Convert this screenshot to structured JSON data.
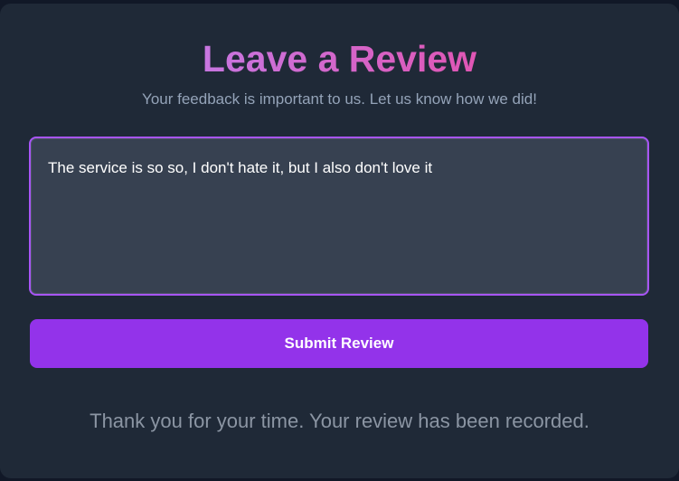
{
  "header": {
    "title": "Leave a Review",
    "subtitle": "Your feedback is important to us. Let us know how we did!"
  },
  "form": {
    "review_value": "The service is so so, I don't hate it, but I also don't love it",
    "submit_label": "Submit Review"
  },
  "status": {
    "message": "Thank you for your time. Your review has been recorded."
  },
  "colors": {
    "accent": "#9333ea",
    "border": "#a855f7",
    "card": "#1f2937"
  }
}
